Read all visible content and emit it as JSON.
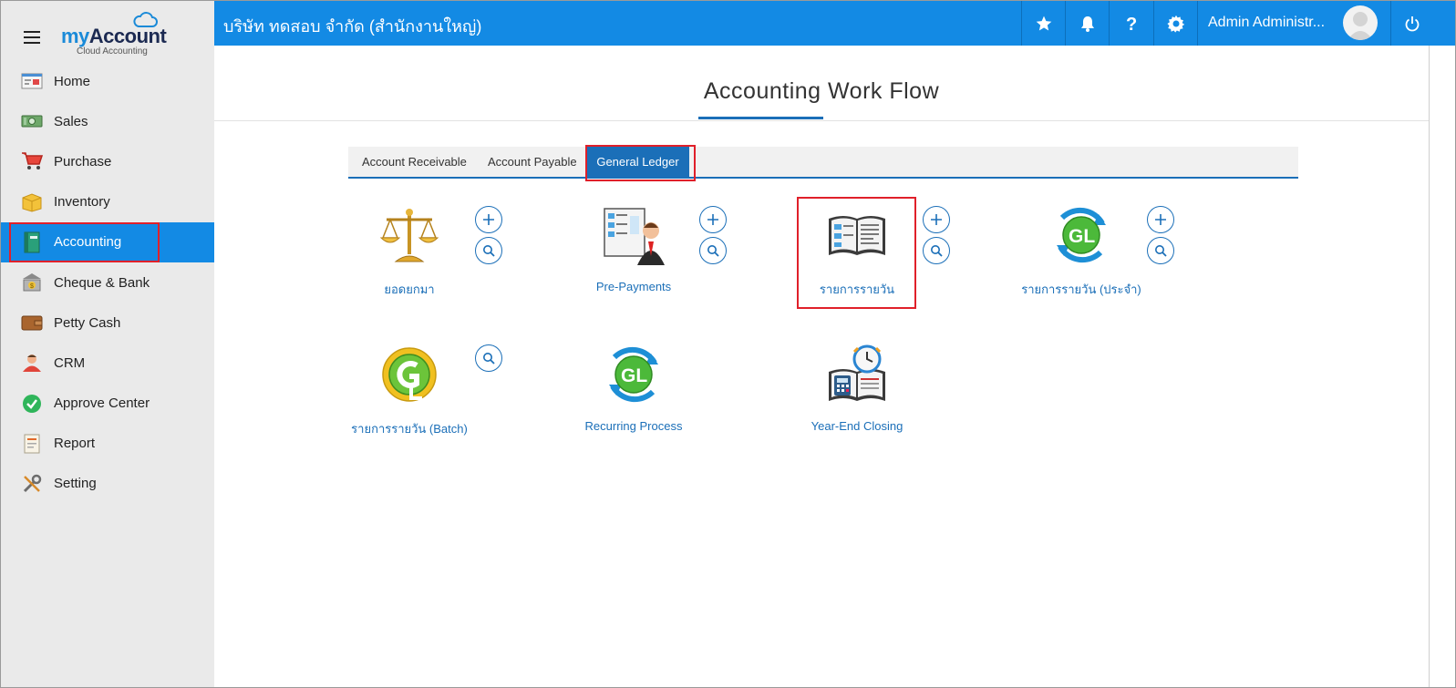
{
  "app": {
    "logo_text_my": "my",
    "logo_text_account": "Account",
    "logo_subtitle": "Cloud Accounting"
  },
  "sidebar": {
    "items": [
      {
        "label": "Home",
        "icon": "home-icon"
      },
      {
        "label": "Sales",
        "icon": "sales-icon"
      },
      {
        "label": "Purchase",
        "icon": "cart-icon"
      },
      {
        "label": "Inventory",
        "icon": "box-icon"
      },
      {
        "label": "Accounting",
        "icon": "book-icon",
        "active": true
      },
      {
        "label": "Cheque & Bank",
        "icon": "bank-icon"
      },
      {
        "label": "Petty Cash",
        "icon": "wallet-icon"
      },
      {
        "label": "CRM",
        "icon": "people-icon"
      },
      {
        "label": "Approve Center",
        "icon": "check-icon"
      },
      {
        "label": "Report",
        "icon": "report-icon"
      },
      {
        "label": "Setting",
        "icon": "tools-icon"
      }
    ]
  },
  "header": {
    "company": "บริษัท ทดสอบ จำกัด (สำนักงานใหญ่)",
    "user_name": "Admin Administr...",
    "icons": [
      "star-icon",
      "bell-icon",
      "help-icon",
      "gear-icon",
      "power-icon"
    ]
  },
  "main": {
    "title": "Accounting Work Flow",
    "tabs": [
      {
        "label": "Account Receivable"
      },
      {
        "label": "Account Payable"
      },
      {
        "label": "General Ledger",
        "active": true
      }
    ],
    "tiles": [
      {
        "label": "ยอดยกมา",
        "icon": "scales-icon",
        "add": true,
        "search": true
      },
      {
        "label": "Pre-Payments",
        "icon": "businessman-book-icon",
        "add": true,
        "search": true
      },
      {
        "label": "รายการรายวัน",
        "icon": "open-book-icon",
        "add": true,
        "search": true,
        "highlighted": true
      },
      {
        "label": "รายการรายวัน (ประจำ)",
        "icon": "gl-recurring-icon",
        "add": true,
        "search": true
      },
      {
        "label": "รายการรายวัน (Batch)",
        "icon": "gl-batch-icon",
        "add": false,
        "search": true
      },
      {
        "label": "Recurring Process",
        "icon": "gl-process-icon",
        "add": false,
        "search": false
      },
      {
        "label": "Year-End Closing",
        "icon": "calculator-clock-icon",
        "add": false,
        "search": false
      }
    ]
  },
  "colors": {
    "brand_blue": "#138ae4",
    "link_blue": "#1b6fb8",
    "highlight_red": "#e0202a",
    "sidebar_bg": "#eaeaea"
  }
}
